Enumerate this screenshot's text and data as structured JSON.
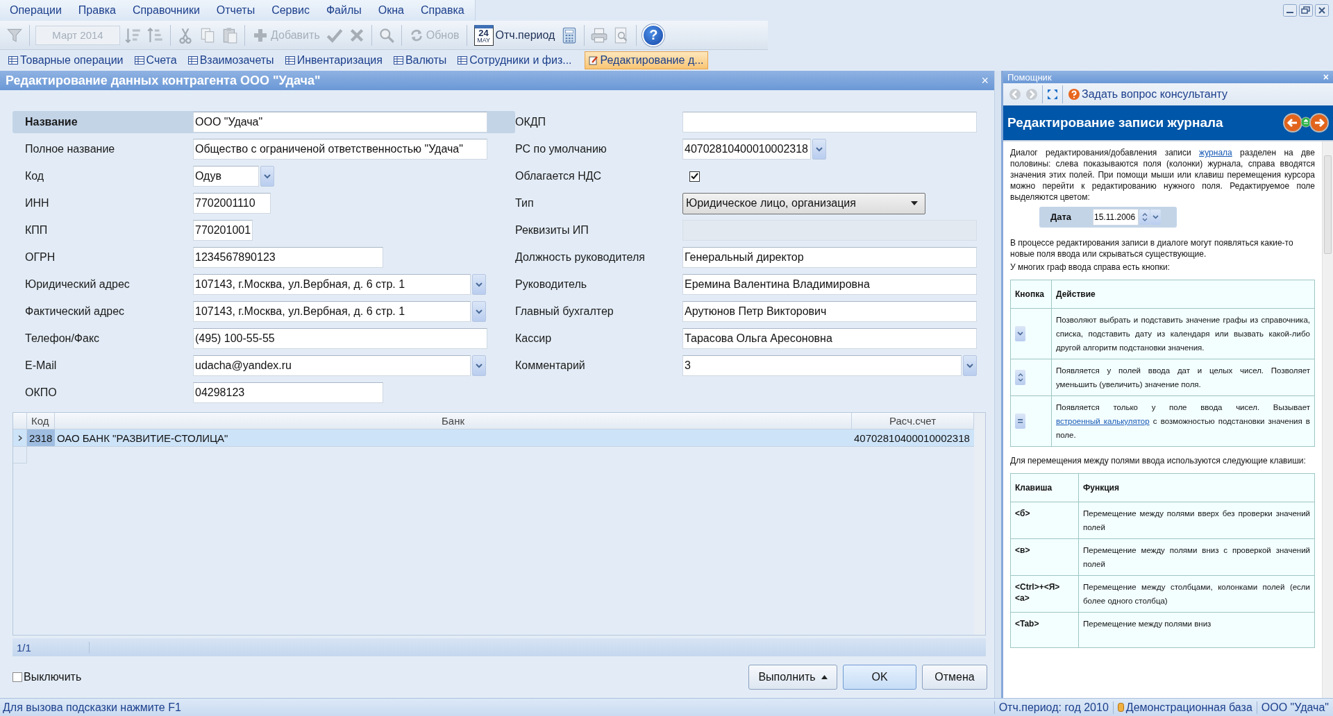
{
  "menu": [
    {
      "label": "Операции"
    },
    {
      "label": "Правка"
    },
    {
      "label": "Справочники"
    },
    {
      "label": "Отчеты"
    },
    {
      "label": "Сервис"
    },
    {
      "label": "Файлы"
    },
    {
      "label": "Окна"
    },
    {
      "label": "Справка"
    }
  ],
  "toolbar": {
    "date_field": {
      "value": "Март 2014",
      "disabled": true
    },
    "add_button": {
      "label": "Добавить",
      "disabled": true
    },
    "refresh_button": {
      "label": "Обнов",
      "disabled": true
    },
    "period_button": {
      "label": "Отч.период",
      "day": "24",
      "month": "MAY",
      "disabled": false
    },
    "help_button": {
      "label": "?"
    }
  },
  "tabs": [
    {
      "label": "Товарные операции",
      "selected": false
    },
    {
      "label": "Счета",
      "selected": false
    },
    {
      "label": "Взаимозачеты",
      "selected": false
    },
    {
      "label": "Инвентаризация",
      "selected": false
    },
    {
      "label": "Валюты",
      "selected": false
    },
    {
      "label": "Сотрудники и физ...",
      "selected": false
    },
    {
      "label": "Редактирование д...",
      "selected": true
    }
  ],
  "dialog": {
    "title": "Редактирование данных контрагента ООО \"Удача\"",
    "close": "×",
    "left_fields": [
      {
        "label": "Название",
        "value": "ООО \"Удача\"",
        "kind": "text",
        "selected": true
      },
      {
        "label": "Полное название",
        "value": "Общество с ограниченой ответственностью \"Удача\"",
        "kind": "text",
        "selected": false
      },
      {
        "label": "Код",
        "value": "Одув",
        "kind": "combo",
        "selected": false
      },
      {
        "label": "ИНН",
        "value": "7702001110",
        "kind": "text",
        "selected": false
      },
      {
        "label": "КПП",
        "value": "770201001",
        "kind": "text",
        "selected": false
      },
      {
        "label": "ОГРН",
        "value": "1234567890123",
        "kind": "text",
        "selected": false
      },
      {
        "label": "Юридический адрес",
        "value": "107143, г.Москва, ул.Вербная, д. 6 стр. 1",
        "kind": "combo",
        "selected": false
      },
      {
        "label": "Фактический адрес",
        "value": "107143, г.Москва, ул.Вербная, д. 6 стр. 1",
        "kind": "combo",
        "selected": false
      },
      {
        "label": "Телефон/Факс",
        "value": "(495) 100-55-55",
        "kind": "text",
        "selected": false
      },
      {
        "label": "E-Mail",
        "value": "udacha@yandex.ru",
        "kind": "combo",
        "selected": false
      },
      {
        "label": "ОКПО",
        "value": "04298123",
        "kind": "text",
        "selected": false
      }
    ],
    "right_fields": [
      {
        "label": "ОКДП",
        "kind": "text",
        "selected": false
      },
      {
        "label": "РС по умолчанию",
        "value": "40702810400010002318",
        "kind": "combo",
        "selected": false
      },
      {
        "label": "Облагается НДС",
        "kind": "checkbox",
        "checked": true,
        "selected": false
      },
      {
        "label": "Тип",
        "value": "Юридическое лицо, организация",
        "kind": "select",
        "selected": false
      },
      {
        "label": "Реквизиты ИП",
        "kind": "readonly",
        "selected": false
      },
      {
        "label": "Должность руководителя",
        "value": "Генеральный директор",
        "kind": "text",
        "selected": false
      },
      {
        "label": "Руководитель",
        "value": "Еремина Валентина Владимировна",
        "kind": "text",
        "selected": false
      },
      {
        "label": "Главный бухгалтер",
        "value": "Арутюнов Петр Викторович",
        "kind": "text",
        "selected": false
      },
      {
        "label": "Кассир",
        "value": "Тарасова Ольга Аресоновна",
        "kind": "text",
        "selected": false
      },
      {
        "label": "Комментарий",
        "value": "3",
        "kind": "combo",
        "selected": false
      }
    ],
    "table": {
      "columns": [
        "Код",
        "Банк",
        "Расч.счет"
      ],
      "rows": [
        {
          "cells": [
            "2318",
            "ОАО БАНК \"РАЗВИТИЕ-СТОЛИЦА\"",
            "40702810400010002318"
          ],
          "selected": true
        }
      ],
      "footer": "1/1"
    },
    "disable_checkbox": {
      "label": "Выключить",
      "checked": false
    },
    "buttons": [
      {
        "label": "Выполнить",
        "kind": "menu"
      },
      {
        "label": "OK",
        "kind": "default"
      },
      {
        "label": "Отмена",
        "kind": "plain"
      }
    ]
  },
  "helper": {
    "title": "Помощник",
    "close": "×",
    "ask_button": "Задать вопрос консультанту",
    "heading": "Редактирование записи журнала",
    "intro": [
      {
        "text": "Диалог редактирования/добавления записи ",
        "link": false
      },
      {
        "text": "журнала",
        "link": true
      },
      {
        "text": " разделен на две половины: слева показываются поля (колонки) журнала, справа вводятся значения этих полей. При помощи мыши или клавиш перемещения курсора можно перейти к редактированию нужного поля. Редактируемое поле выделяются цветом:",
        "link": false
      }
    ],
    "example": {
      "label": "Дата",
      "value": "15.11.2006"
    },
    "paragraphs": [
      "В процессе редактирования записи в диалоге могут появляться какие-то новые поля ввода или скрываться существующие.",
      "У многих граф ввода справа есть кнопки:"
    ],
    "buttons_table": {
      "columns": [
        "Кнопка",
        "Действие"
      ],
      "rows": [
        {
          "kind": "dropdown",
          "parts": [
            {
              "text": "Позволяют выбрать и подставить значение графы из справочника, списка, подставить дату из календаря или вызвать какой-либо другой алгоритм подстановки значения.",
              "link": false
            }
          ]
        },
        {
          "kind": "spinner",
          "parts": [
            {
              "text": "Появляется у полей ввода дат и целых чисел. Позволяет уменьшить (увеличить) значение поля.",
              "link": false
            }
          ]
        },
        {
          "kind": "calculator",
          "label": "=",
          "parts": [
            {
              "text": "Появляется только у поле ввода чисел. Вызывает ",
              "link": false
            },
            {
              "text": "встроенный калькулятор",
              "link": true
            },
            {
              "text": " с возможностью подстановки значения в поле.",
              "link": false
            }
          ]
        }
      ]
    },
    "keys_intro": "Для перемещения между полями ввода используются следующие клавиши:",
    "keys_table": {
      "columns": [
        "Клавиша",
        "Функция"
      ],
      "rows": [
        {
          "key": "<б>",
          "text": "Перемещение между полями вверх без проверки значений полей"
        },
        {
          "key": "<в>",
          "text": "Перемещение между полями вниз с проверкой значений полей"
        },
        {
          "key": "<Ctrl>+<Я> <а>",
          "text": "Перемещение между столбцами, колонками полей (если более одного столбца)"
        },
        {
          "key": "<Tab>",
          "text": "Перемещение между полями вниз"
        }
      ]
    }
  },
  "status_bar": {
    "hint": "Для вызова подсказки нажмите F1",
    "period": "Отч.период: год 2010",
    "database": "Демонстрационная база",
    "company": "ООО \"Удача\""
  }
}
